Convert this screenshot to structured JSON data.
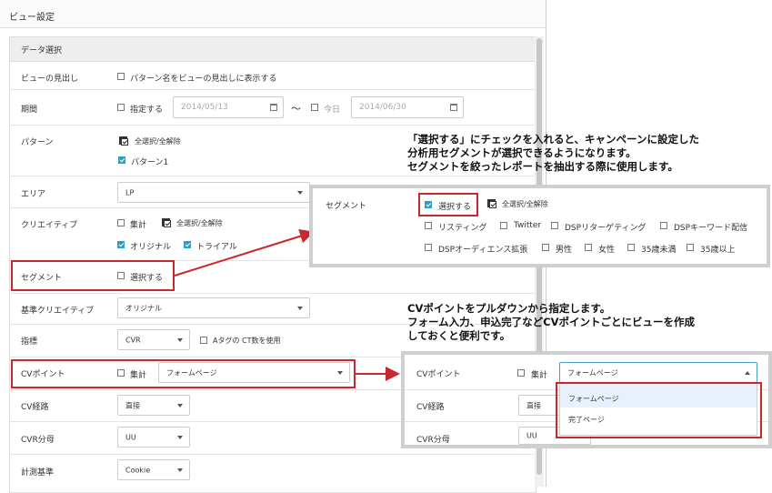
{
  "dialog": {
    "title": "ビュー設定",
    "section_title": "データ選択"
  },
  "rows": {
    "heading": {
      "label": "ビューの見出し",
      "checkbox_label": "パターン名をビューの見出しに表示する"
    },
    "period": {
      "label": "期間",
      "specify_label": "指定する",
      "start_placeholder": "2014/05/13",
      "tilde": "〜",
      "today_label": "今日",
      "end_placeholder": "2014/06/30"
    },
    "pattern": {
      "label": "パターン",
      "select_all": "全選択/全解除",
      "item": "パターン1"
    },
    "area": {
      "label": "エリア",
      "value": "LP"
    },
    "creative": {
      "label": "クリエイティブ",
      "aggregate": "集計",
      "select_all": "全選択/全解除",
      "items": [
        "オリジナル",
        "トライアル"
      ]
    },
    "segment": {
      "label": "セグメント",
      "checkbox_label": "選択する"
    },
    "base_creative": {
      "label": "基準クリエイティブ",
      "value": "オリジナル"
    },
    "metric": {
      "label": "指標",
      "value": "CVR",
      "checkbox_label": "Aタグの CT数を使用"
    },
    "cv_point": {
      "label": "CVポイント",
      "aggregate": "集計",
      "value": "フォームページ"
    },
    "cv_path": {
      "label": "CV経路",
      "value": "直接"
    },
    "cvr_denominator": {
      "label": "CVR分母",
      "value": "UU"
    },
    "measure_basis": {
      "label": "計測基準",
      "value": "Cookie"
    }
  },
  "callouts": {
    "segment": [
      "「選択する」にチェックを入れると、キャンペーンに設定した",
      "分析用セグメントが選択できるようになります。",
      "セグメントを絞ったレポートを抽出する際に使用します。"
    ],
    "cv_point": [
      "CVポイントをプルダウンから指定します。",
      "フォーム入力、申込完了などCVポイントごとにビューを作成",
      "しておくと便利です。"
    ]
  },
  "segment_zoom": {
    "label": "セグメント",
    "select_label": "選択する",
    "select_all": "全選択/全解除",
    "row1": [
      "リスティング",
      "Twitter",
      "DSPリターゲティング",
      "DSPキーワード配信"
    ],
    "row2": [
      "DSPオーディエンス拡張",
      "男性",
      "女性",
      "35歳未満",
      "35歳以上"
    ]
  },
  "cv_zoom": {
    "cv_point_label": "CVポイント",
    "aggregate": "集計",
    "value": "フォームページ",
    "options": [
      "フォームページ",
      "完了ページ"
    ],
    "cv_path_label": "CV経路",
    "cv_path_value": "直接",
    "cvr_label": "CVR分母",
    "cvr_value": "UU"
  },
  "colors": {
    "accent": "#29a0c8",
    "highlight": "#c8282e",
    "frame": "#cfcfcf"
  }
}
